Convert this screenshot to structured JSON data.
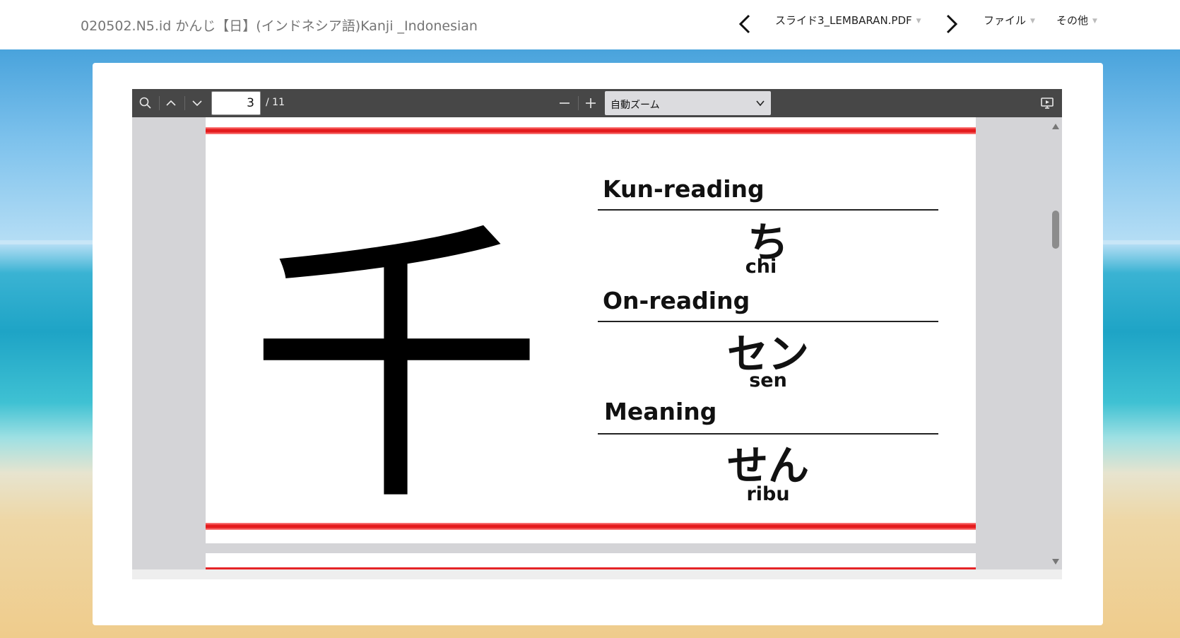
{
  "header": {
    "title": "020502.N5.id かんじ【日】(インドネシア語)Kanji _Indonesian",
    "file_name": "スライド3_LEMBARAN.PDF",
    "menu_file": "ファイル",
    "menu_other": "その他"
  },
  "toolbar": {
    "page_value": "3",
    "page_count": "/ 11",
    "zoom_label": "自動ズーム",
    "icons": {
      "search": "search-icon",
      "prev_page": "chevron-up-icon",
      "next_page": "chevron-down-icon",
      "zoom_out": "minus-icon",
      "zoom_in": "plus-icon",
      "presentation": "presentation-icon"
    }
  },
  "slide": {
    "kanji": "千",
    "sections": [
      {
        "label": "Kun-reading",
        "value": "ち",
        "romaji": "chi"
      },
      {
        "label": "On-reading",
        "value": "セン",
        "romaji": "sen"
      },
      {
        "label": "Meaning",
        "value": "せん",
        "romaji": "ribu"
      }
    ]
  },
  "colors": {
    "accent_red": "#e41a1c",
    "toolbar_bg": "#474747",
    "viewer_bg": "#d4d4d7"
  }
}
